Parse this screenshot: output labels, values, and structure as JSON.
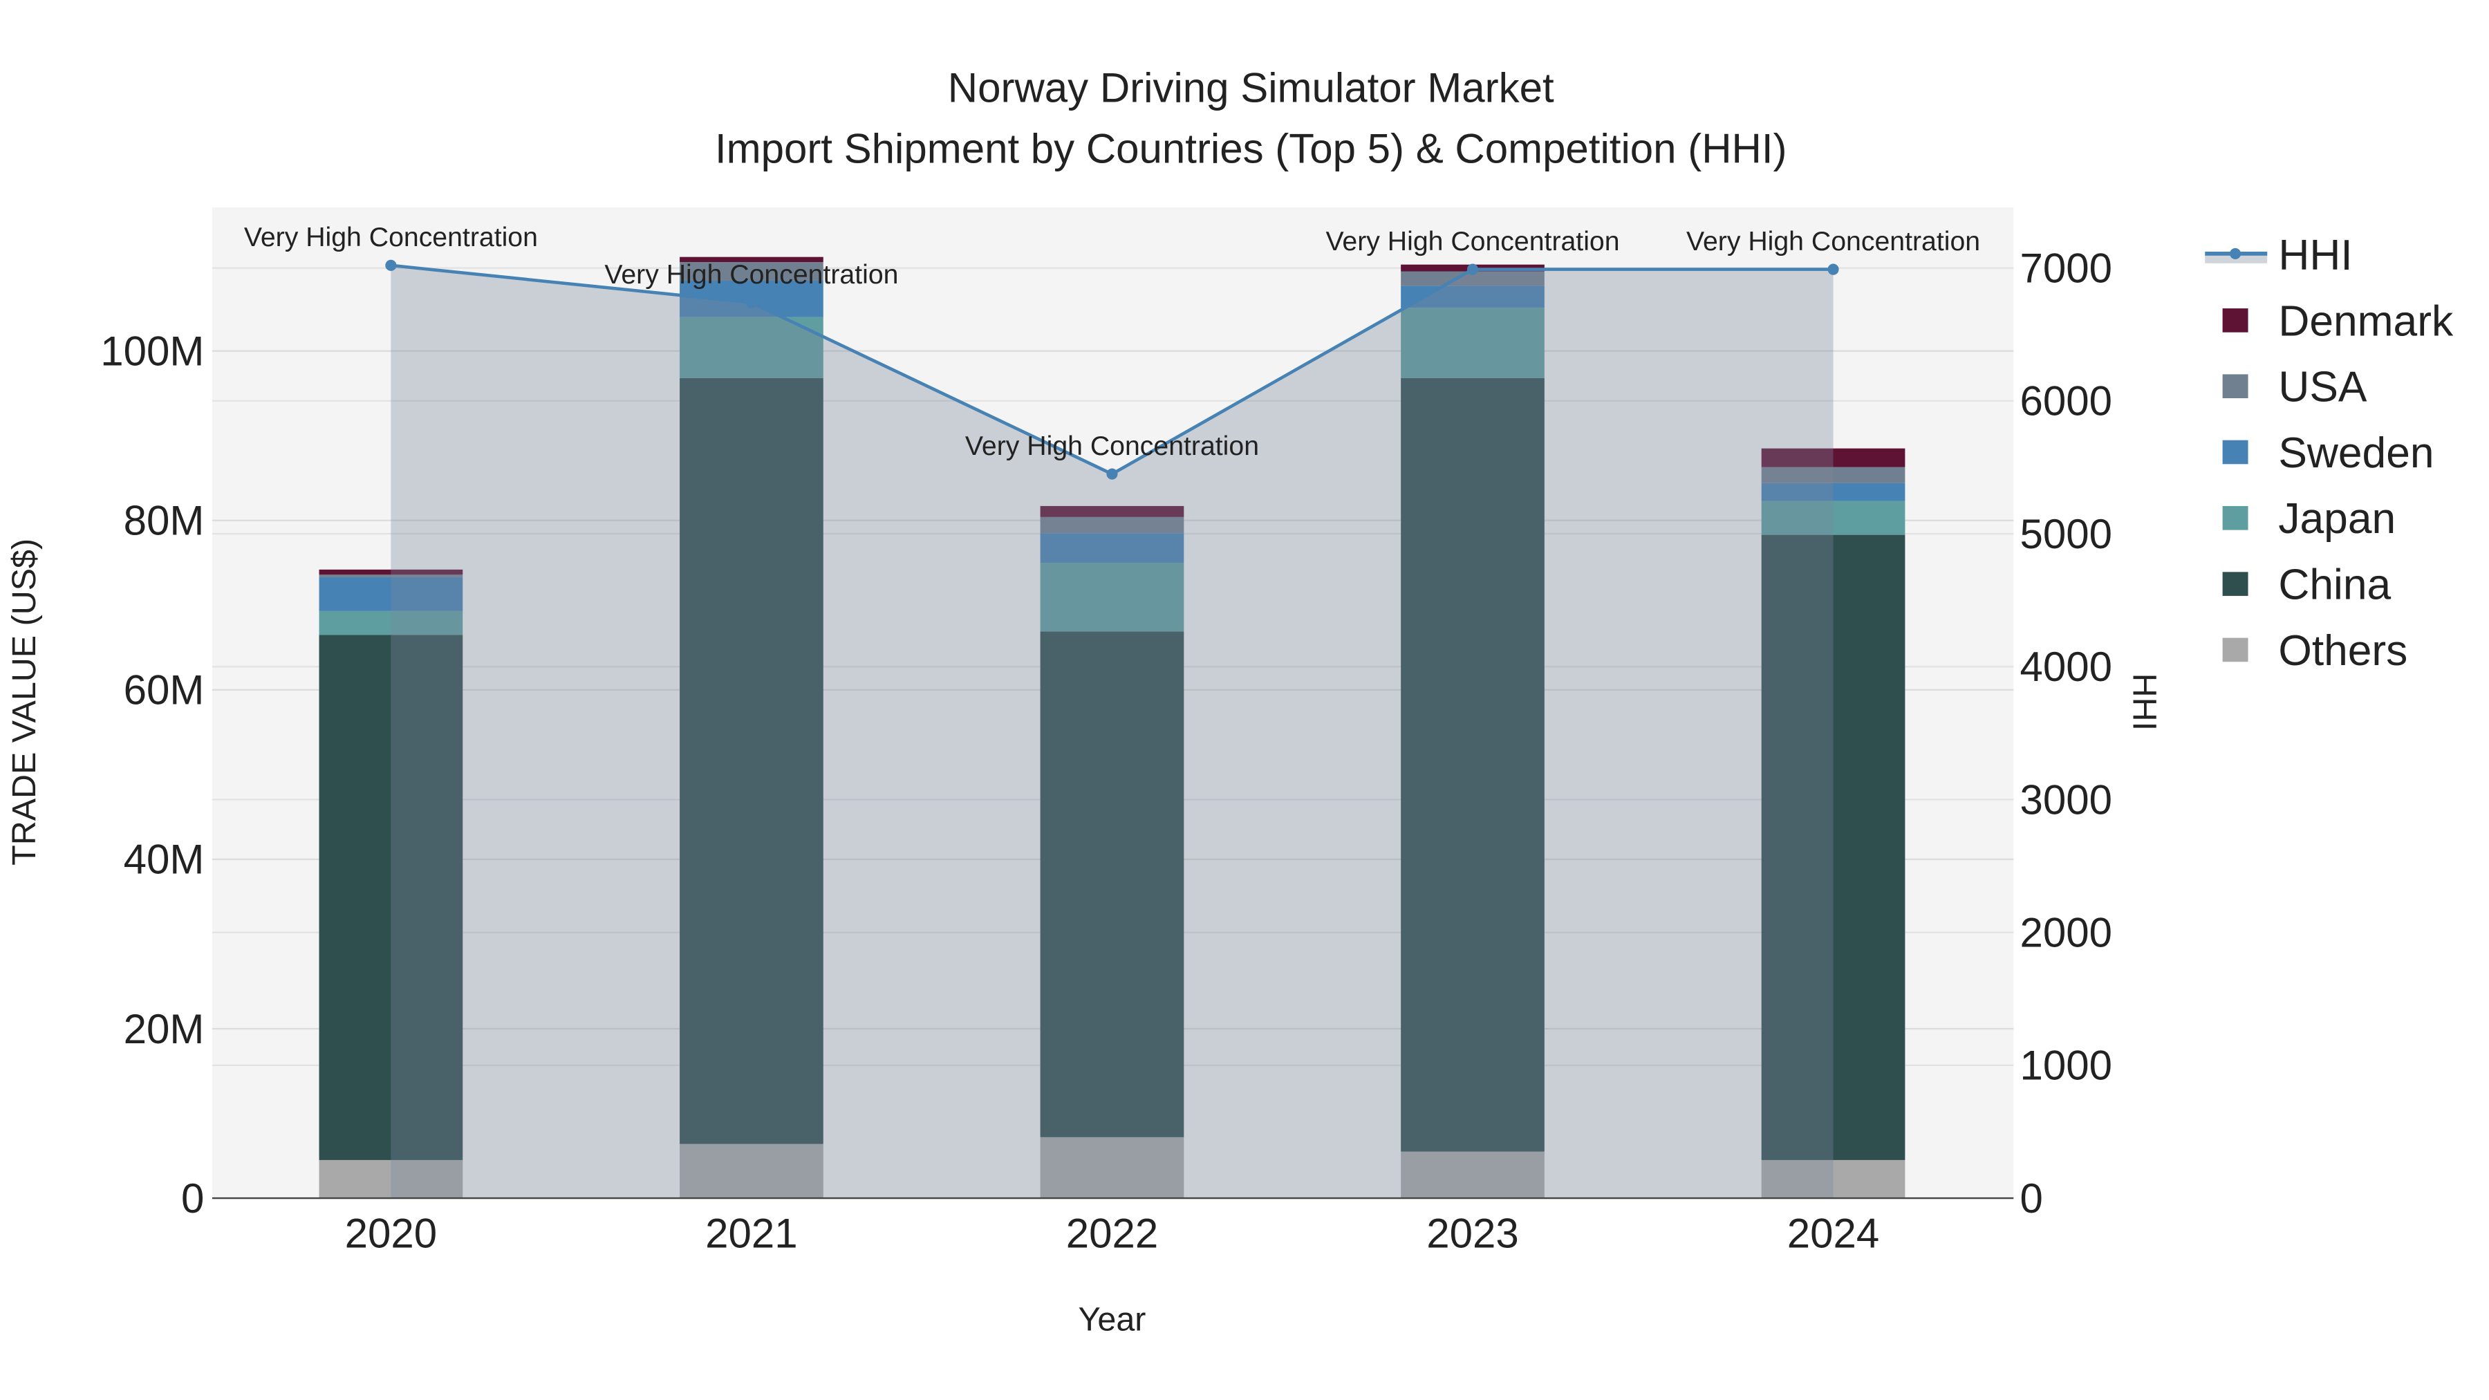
{
  "chart_data": {
    "type": "bar",
    "stacked": true,
    "title": "Norway Driving Simulator Market",
    "subtitle": "Import Shipment by Countries (Top 5) & Competition (HHI)",
    "xlabel": "Year",
    "ylabel": "TRADE VALUE (US$)",
    "y2label": "HHI",
    "categories": [
      "2020",
      "2021",
      "2022",
      "2023",
      "2024"
    ],
    "ylim": [
      0,
      112000000
    ],
    "y2lim": [
      0,
      7450
    ],
    "yticks": [
      0,
      20000000,
      40000000,
      60000000,
      80000000,
      100000000
    ],
    "ytick_labels": [
      "0",
      "20M",
      "40M",
      "60M",
      "80M",
      "100M"
    ],
    "y2ticks": [
      0,
      1000,
      2000,
      3000,
      4000,
      5000,
      6000,
      7000
    ],
    "y2tick_labels": [
      "0",
      "1000",
      "2000",
      "3000",
      "4000",
      "5000",
      "6000",
      "7000"
    ],
    "series": [
      {
        "name": "Others",
        "color": "#a9a9a9",
        "values": [
          4500000,
          6400000,
          7200000,
          5500000,
          4500000
        ]
      },
      {
        "name": "China",
        "color": "#2f4f4f",
        "values": [
          62000000,
          90400000,
          59700000,
          91300000,
          73800000
        ]
      },
      {
        "name": "Japan",
        "color": "#5f9ea0",
        "values": [
          2800000,
          7200000,
          8100000,
          8300000,
          4000000
        ]
      },
      {
        "name": "Sweden",
        "color": "#4682b4",
        "values": [
          4000000,
          4300000,
          3500000,
          2600000,
          2100000
        ]
      },
      {
        "name": "USA",
        "color": "#708090",
        "values": [
          300000,
          2200000,
          1900000,
          1700000,
          1900000
        ]
      },
      {
        "name": "Denmark",
        "color": "#5e1234",
        "values": [
          600000,
          600000,
          1300000,
          800000,
          2200000
        ]
      }
    ],
    "line": {
      "name": "HHI",
      "color": "#4682b4",
      "values": [
        7020,
        6740,
        5450,
        6990,
        6990
      ],
      "annotations": [
        "Very High Concentration",
        "Very High Concentration",
        "Very High Concentration",
        "Very High Concentration",
        "Very High Concentration"
      ]
    },
    "legend": {
      "placement": "right",
      "items": [
        "HHI",
        "Denmark",
        "USA",
        "Sweden",
        "Japan",
        "China",
        "Others"
      ]
    },
    "grid": true
  }
}
